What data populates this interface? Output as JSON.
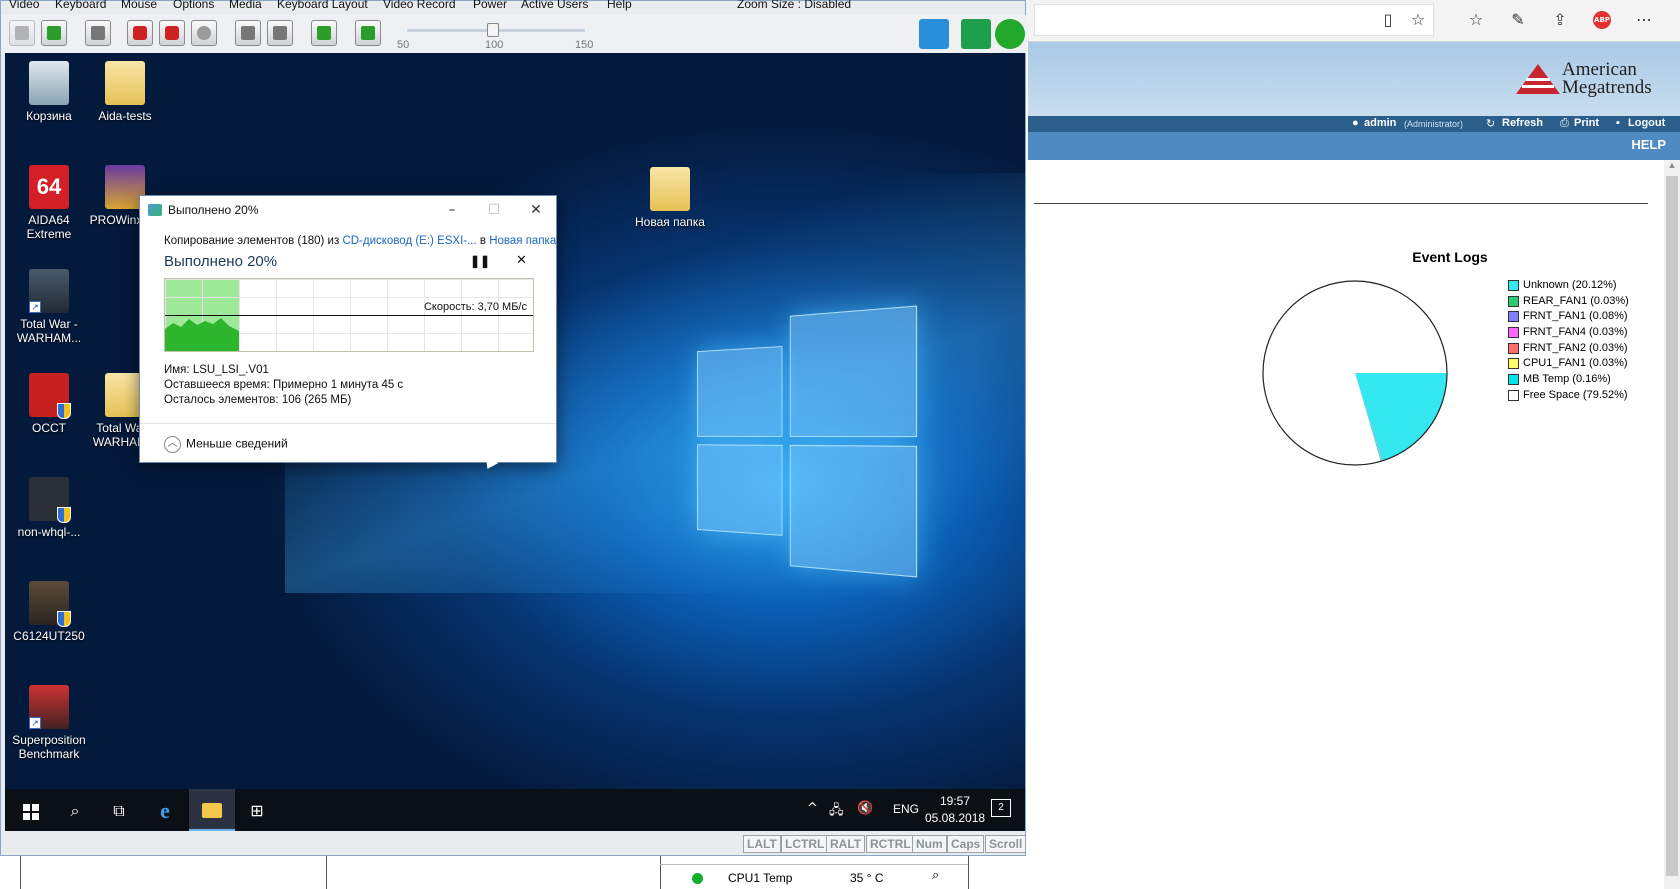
{
  "kvm": {
    "menu": [
      "Video",
      "Keyboard",
      "Mouse",
      "Options",
      "Media",
      "Keyboard Layout",
      "Video Record",
      "Power",
      "Active Users",
      "Help"
    ],
    "zoom_label": "Zoom Size : Disabled",
    "zoom_ticks": [
      "50",
      "100",
      "150"
    ],
    "zoom_value": 100,
    "status_keys": [
      "LALT",
      "LCTRL",
      "RALT",
      "RCTRL",
      "Num",
      "Caps",
      "Scroll"
    ]
  },
  "desktop": {
    "icons": [
      {
        "label": "Корзина",
        "icon": "recycle-bin-icon"
      },
      {
        "label": "Aida-tests",
        "icon": "folder-icon"
      },
      {
        "label": "AIDA64 Extreme",
        "icon": "aida64-icon",
        "glyph": "64"
      },
      {
        "label": "PROWinx (2)",
        "icon": "winrar-icon"
      },
      {
        "label": "Total War - WARHAM...",
        "icon": "total-war-icon"
      },
      {
        "label": "OCCT",
        "icon": "occt-icon"
      },
      {
        "label": "Total War - WARHAM...",
        "icon": "folder-icon"
      },
      {
        "label": "non-whql-...",
        "icon": "installer-icon"
      },
      {
        "label": "C6124UT250",
        "icon": "installer-icon"
      },
      {
        "label": "Superposition Benchmark",
        "icon": "superposition-icon"
      },
      {
        "label": "Новая папка",
        "icon": "folder-icon"
      }
    ]
  },
  "copy_dialog": {
    "title": "Выполнено 20%",
    "desc_prefix": "Копирование элементов (180) из",
    "source": "CD-дисковод (E:) ESXI-...",
    "desc_middle": "в",
    "dest": "Новая папка",
    "progress_label": "Выполнено 20%",
    "progress": 0.2,
    "speed": "Скорость: 3,70 МБ/с",
    "name_label": "Имя:",
    "name_value": "LSU_LSI_.V01",
    "time_label": "Оставшееся время:",
    "time_value": "Примерно 1 минута 45 с",
    "items_label": "Осталось элементов:",
    "items_value": "106 (265 МБ)",
    "less_details": "Меньше сведений"
  },
  "taskbar": {
    "lang": "ENG",
    "time": "19:57",
    "date": "05.08.2018",
    "notifications": "2"
  },
  "bmc": {
    "logo_line1": "American",
    "logo_line2": "Megatrends",
    "user": "admin",
    "role": "(Administrator)",
    "refresh": "Refresh",
    "print": "Print",
    "logout": "Logout",
    "help": "HELP"
  },
  "sensor_row": {
    "name": "CPU1 Temp",
    "value": "35 ° C",
    "status_color": "#0fae2c"
  },
  "chart_data": {
    "type": "pie",
    "title": "Event Logs",
    "categories": [
      "Unknown (20.12%)",
      "REAR_FAN1 (0.03%)",
      "FRNT_FAN1 (0.08%)",
      "FRNT_FAN4 (0.03%)",
      "FRNT_FAN2 (0.03%)",
      "CPU1_FAN1 (0.03%)",
      "MB Temp (0.16%)",
      "Free Space (79.52%)"
    ],
    "values": [
      20.12,
      0.03,
      0.08,
      0.03,
      0.03,
      0.03,
      0.16,
      79.52
    ],
    "colors": [
      "#33e8f0",
      "#2ecc71",
      "#7f7fff",
      "#ff66ff",
      "#ff6f6f",
      "#ffff66",
      "#00e5e5",
      "#ffffff"
    ],
    "legend_position": "right"
  }
}
